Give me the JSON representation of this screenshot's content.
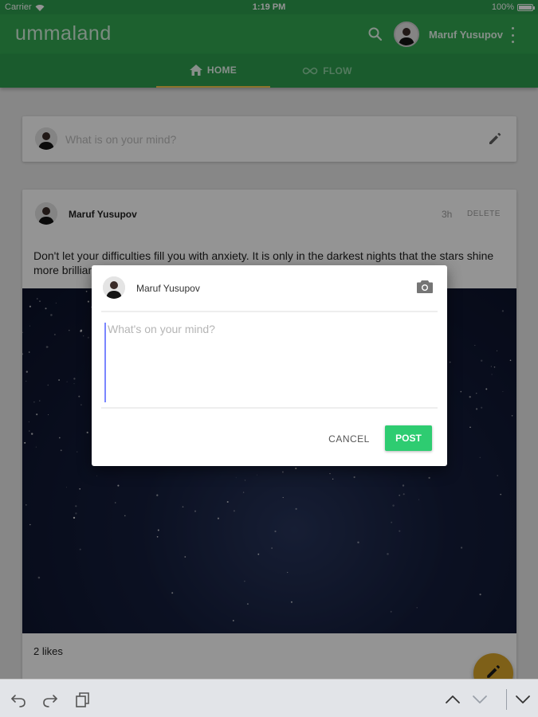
{
  "status_bar": {
    "carrier": "Carrier",
    "time": "1:19 PM",
    "battery": "100%"
  },
  "app_bar": {
    "logo": "ummaland",
    "username": "Maruf Yusupov",
    "icons": [
      "search-icon",
      "more-vert-icon"
    ]
  },
  "tabs": [
    {
      "label": "HOME",
      "icon": "home-icon",
      "active": true
    },
    {
      "label": "FLOW",
      "icon": "infinity-icon",
      "active": false
    }
  ],
  "composer": {
    "placeholder": "What is on your mind?",
    "icon": "pencil-icon"
  },
  "post": {
    "author": "Maruf Yusupov",
    "time": "3h",
    "delete_label": "DELETE",
    "text": "Don't let your difficulties fill you with anxiety. It is only in the darkest nights that the stars shine more brilliantly.",
    "likes": "2 likes"
  },
  "dialog": {
    "author": "Maruf Yusupov",
    "placeholder": "What's on your mind?",
    "value": "",
    "cancel_label": "CANCEL",
    "post_label": "POST",
    "icon": "camera-icon"
  },
  "fab": {
    "icon": "pencil-icon"
  },
  "bottom_toolbar": {
    "icons": [
      "undo-icon",
      "redo-icon",
      "clipboard-icon",
      "chevron-up-icon",
      "chevron-down-icon",
      "keyboard-dismiss-icon"
    ]
  },
  "colors": {
    "primary": "#32a852",
    "primary_dark": "#2e9e4f",
    "accent": "#2ecc71",
    "fab": "#d9a62a",
    "tab_indicator": "#f2c94c"
  }
}
